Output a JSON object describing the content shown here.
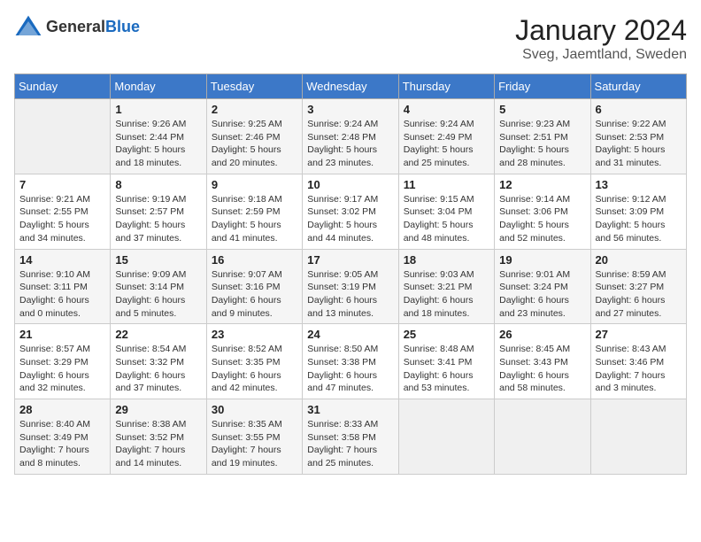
{
  "logo": {
    "general": "General",
    "blue": "Blue"
  },
  "title": "January 2024",
  "location": "Sveg, Jaemtland, Sweden",
  "days_of_week": [
    "Sunday",
    "Monday",
    "Tuesday",
    "Wednesday",
    "Thursday",
    "Friday",
    "Saturday"
  ],
  "weeks": [
    [
      {
        "day": "",
        "info": ""
      },
      {
        "day": "1",
        "info": "Sunrise: 9:26 AM\nSunset: 2:44 PM\nDaylight: 5 hours\nand 18 minutes."
      },
      {
        "day": "2",
        "info": "Sunrise: 9:25 AM\nSunset: 2:46 PM\nDaylight: 5 hours\nand 20 minutes."
      },
      {
        "day": "3",
        "info": "Sunrise: 9:24 AM\nSunset: 2:48 PM\nDaylight: 5 hours\nand 23 minutes."
      },
      {
        "day": "4",
        "info": "Sunrise: 9:24 AM\nSunset: 2:49 PM\nDaylight: 5 hours\nand 25 minutes."
      },
      {
        "day": "5",
        "info": "Sunrise: 9:23 AM\nSunset: 2:51 PM\nDaylight: 5 hours\nand 28 minutes."
      },
      {
        "day": "6",
        "info": "Sunrise: 9:22 AM\nSunset: 2:53 PM\nDaylight: 5 hours\nand 31 minutes."
      }
    ],
    [
      {
        "day": "7",
        "info": "Sunrise: 9:21 AM\nSunset: 2:55 PM\nDaylight: 5 hours\nand 34 minutes."
      },
      {
        "day": "8",
        "info": "Sunrise: 9:19 AM\nSunset: 2:57 PM\nDaylight: 5 hours\nand 37 minutes."
      },
      {
        "day": "9",
        "info": "Sunrise: 9:18 AM\nSunset: 2:59 PM\nDaylight: 5 hours\nand 41 minutes."
      },
      {
        "day": "10",
        "info": "Sunrise: 9:17 AM\nSunset: 3:02 PM\nDaylight: 5 hours\nand 44 minutes."
      },
      {
        "day": "11",
        "info": "Sunrise: 9:15 AM\nSunset: 3:04 PM\nDaylight: 5 hours\nand 48 minutes."
      },
      {
        "day": "12",
        "info": "Sunrise: 9:14 AM\nSunset: 3:06 PM\nDaylight: 5 hours\nand 52 minutes."
      },
      {
        "day": "13",
        "info": "Sunrise: 9:12 AM\nSunset: 3:09 PM\nDaylight: 5 hours\nand 56 minutes."
      }
    ],
    [
      {
        "day": "14",
        "info": "Sunrise: 9:10 AM\nSunset: 3:11 PM\nDaylight: 6 hours\nand 0 minutes."
      },
      {
        "day": "15",
        "info": "Sunrise: 9:09 AM\nSunset: 3:14 PM\nDaylight: 6 hours\nand 5 minutes."
      },
      {
        "day": "16",
        "info": "Sunrise: 9:07 AM\nSunset: 3:16 PM\nDaylight: 6 hours\nand 9 minutes."
      },
      {
        "day": "17",
        "info": "Sunrise: 9:05 AM\nSunset: 3:19 PM\nDaylight: 6 hours\nand 13 minutes."
      },
      {
        "day": "18",
        "info": "Sunrise: 9:03 AM\nSunset: 3:21 PM\nDaylight: 6 hours\nand 18 minutes."
      },
      {
        "day": "19",
        "info": "Sunrise: 9:01 AM\nSunset: 3:24 PM\nDaylight: 6 hours\nand 23 minutes."
      },
      {
        "day": "20",
        "info": "Sunrise: 8:59 AM\nSunset: 3:27 PM\nDaylight: 6 hours\nand 27 minutes."
      }
    ],
    [
      {
        "day": "21",
        "info": "Sunrise: 8:57 AM\nSunset: 3:29 PM\nDaylight: 6 hours\nand 32 minutes."
      },
      {
        "day": "22",
        "info": "Sunrise: 8:54 AM\nSunset: 3:32 PM\nDaylight: 6 hours\nand 37 minutes."
      },
      {
        "day": "23",
        "info": "Sunrise: 8:52 AM\nSunset: 3:35 PM\nDaylight: 6 hours\nand 42 minutes."
      },
      {
        "day": "24",
        "info": "Sunrise: 8:50 AM\nSunset: 3:38 PM\nDaylight: 6 hours\nand 47 minutes."
      },
      {
        "day": "25",
        "info": "Sunrise: 8:48 AM\nSunset: 3:41 PM\nDaylight: 6 hours\nand 53 minutes."
      },
      {
        "day": "26",
        "info": "Sunrise: 8:45 AM\nSunset: 3:43 PM\nDaylight: 6 hours\nand 58 minutes."
      },
      {
        "day": "27",
        "info": "Sunrise: 8:43 AM\nSunset: 3:46 PM\nDaylight: 7 hours\nand 3 minutes."
      }
    ],
    [
      {
        "day": "28",
        "info": "Sunrise: 8:40 AM\nSunset: 3:49 PM\nDaylight: 7 hours\nand 8 minutes."
      },
      {
        "day": "29",
        "info": "Sunrise: 8:38 AM\nSunset: 3:52 PM\nDaylight: 7 hours\nand 14 minutes."
      },
      {
        "day": "30",
        "info": "Sunrise: 8:35 AM\nSunset: 3:55 PM\nDaylight: 7 hours\nand 19 minutes."
      },
      {
        "day": "31",
        "info": "Sunrise: 8:33 AM\nSunset: 3:58 PM\nDaylight: 7 hours\nand 25 minutes."
      },
      {
        "day": "",
        "info": ""
      },
      {
        "day": "",
        "info": ""
      },
      {
        "day": "",
        "info": ""
      }
    ]
  ]
}
